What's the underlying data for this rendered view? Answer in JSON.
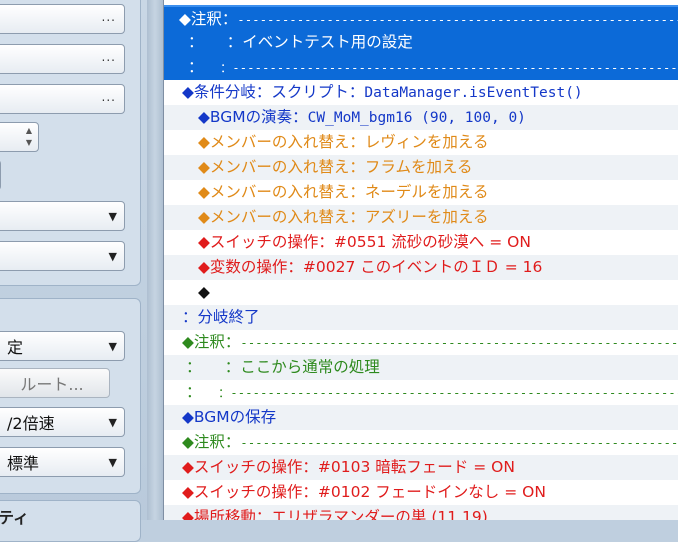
{
  "left_panel": {
    "more_button": "...",
    "speed_label": "/2倍速",
    "standard_label": "標準",
    "partial_label_1": "定",
    "route_button": "ルート...",
    "bottom_partial": "ティ"
  },
  "event_list": {
    "rows": [
      {
        "cmd": "◆注釈：",
        "rest": "---------------------------------------------------------------------"
      },
      {
        "cmd": "：",
        "rest": "　　：イベントテスト用の設定"
      },
      {
        "cmd": "：",
        "rest": "　　：---------------------------------------------------------------"
      },
      {
        "cmd": "◆条件分岐：スクリプト：",
        "rest": "DataManager.isEventTest()"
      },
      {
        "cmd": "◆BGMの演奏：",
        "rest": "CW_MoM_bgm16 (90, 100, 0)"
      },
      {
        "cmd": "◆メンバーの入れ替え：",
        "rest": "レヴィンを加える"
      },
      {
        "cmd": "◆メンバーの入れ替え：",
        "rest": "フラムを加える"
      },
      {
        "cmd": "◆メンバーの入れ替え：",
        "rest": "ネーデルを加える"
      },
      {
        "cmd": "◆メンバーの入れ替え：",
        "rest": "アズリーを加える"
      },
      {
        "cmd": "◆スイッチの操作：",
        "rest": "#0551 流砂の砂漠へ = ON"
      },
      {
        "cmd": "◆変数の操作：",
        "rest": "#0027 このイベントのＩＤ = 16"
      },
      {
        "cmd": "◆",
        "rest": ""
      },
      {
        "cmd": "：分岐終了",
        "rest": ""
      },
      {
        "cmd": "◆注釈：",
        "rest": "---------------------------------------------------------------------"
      },
      {
        "cmd": "：",
        "rest": "　　：ここから通常の処理"
      },
      {
        "cmd": "：",
        "rest": "　　：---------------------------------------------------------------"
      },
      {
        "cmd": "◆BGMの保存",
        "rest": ""
      },
      {
        "cmd": "◆注釈：",
        "rest": "---------------------------------------------------------------------"
      },
      {
        "cmd": "◆スイッチの操作：",
        "rest": "#0103 暗転フェード = ON"
      },
      {
        "cmd": "◆スイッチの操作：",
        "rest": "#0102 フェードインなし = ON"
      },
      {
        "cmd": "◆場所移動：",
        "rest": "エリザラマンダーの巣 (11,19)"
      }
    ]
  }
}
